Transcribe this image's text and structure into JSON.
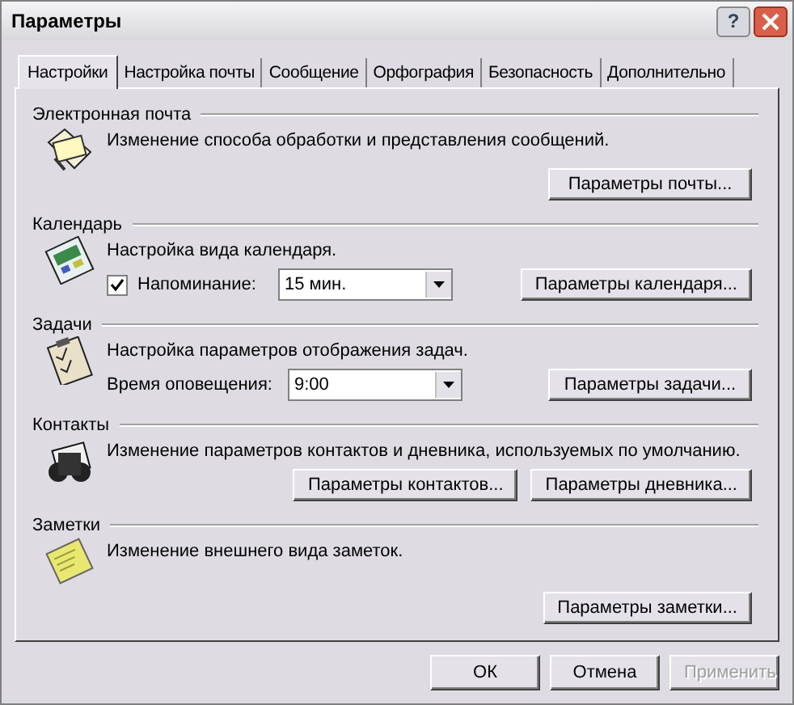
{
  "window": {
    "title": "Параметры",
    "help": "?"
  },
  "tabs": [
    {
      "label": "Настройки",
      "selected": true
    },
    {
      "label": "Настройка почты",
      "selected": false
    },
    {
      "label": "Сообщение",
      "selected": false
    },
    {
      "label": "Орфография",
      "selected": false
    },
    {
      "label": "Безопасность",
      "selected": false
    },
    {
      "label": "Дополнительно",
      "selected": false
    }
  ],
  "sections": [
    {
      "title": "Электронная почта",
      "description": "Изменение способа обработки и представления сообщений.",
      "controls": [
        {
          "kind": "button",
          "label": "Параметры почты..."
        }
      ]
    },
    {
      "title": "Календарь",
      "description": "Настройка вида календаря.",
      "controls": [
        {
          "kind": "checkbox",
          "label": "Напоминание:",
          "checked": true
        },
        {
          "kind": "combo",
          "value": "15 мин."
        },
        {
          "kind": "button",
          "label": "Параметры календаря..."
        }
      ]
    },
    {
      "title": "Задачи",
      "description": "Настройка параметров отображения задач.",
      "controls": [
        {
          "kind": "label",
          "label": "Время оповещения:"
        },
        {
          "kind": "combo",
          "value": "9:00"
        },
        {
          "kind": "button",
          "label": "Параметры задачи..."
        }
      ]
    },
    {
      "title": "Контакты",
      "description": "Изменение параметров контактов и дневника, используемых по умолчанию.",
      "controls": [
        {
          "kind": "button",
          "label": "Параметры контактов..."
        },
        {
          "kind": "button",
          "label": "Параметры дневника..."
        }
      ]
    },
    {
      "title": "Заметки",
      "description": "Изменение внешнего вида заметок.",
      "controls": [
        {
          "kind": "button",
          "label": "Параметры заметки..."
        }
      ]
    }
  ],
  "buttons": [
    {
      "label": "ОК",
      "disabled": false
    },
    {
      "label": "Отмена",
      "disabled": false
    },
    {
      "label": "Применить",
      "disabled": true
    }
  ]
}
